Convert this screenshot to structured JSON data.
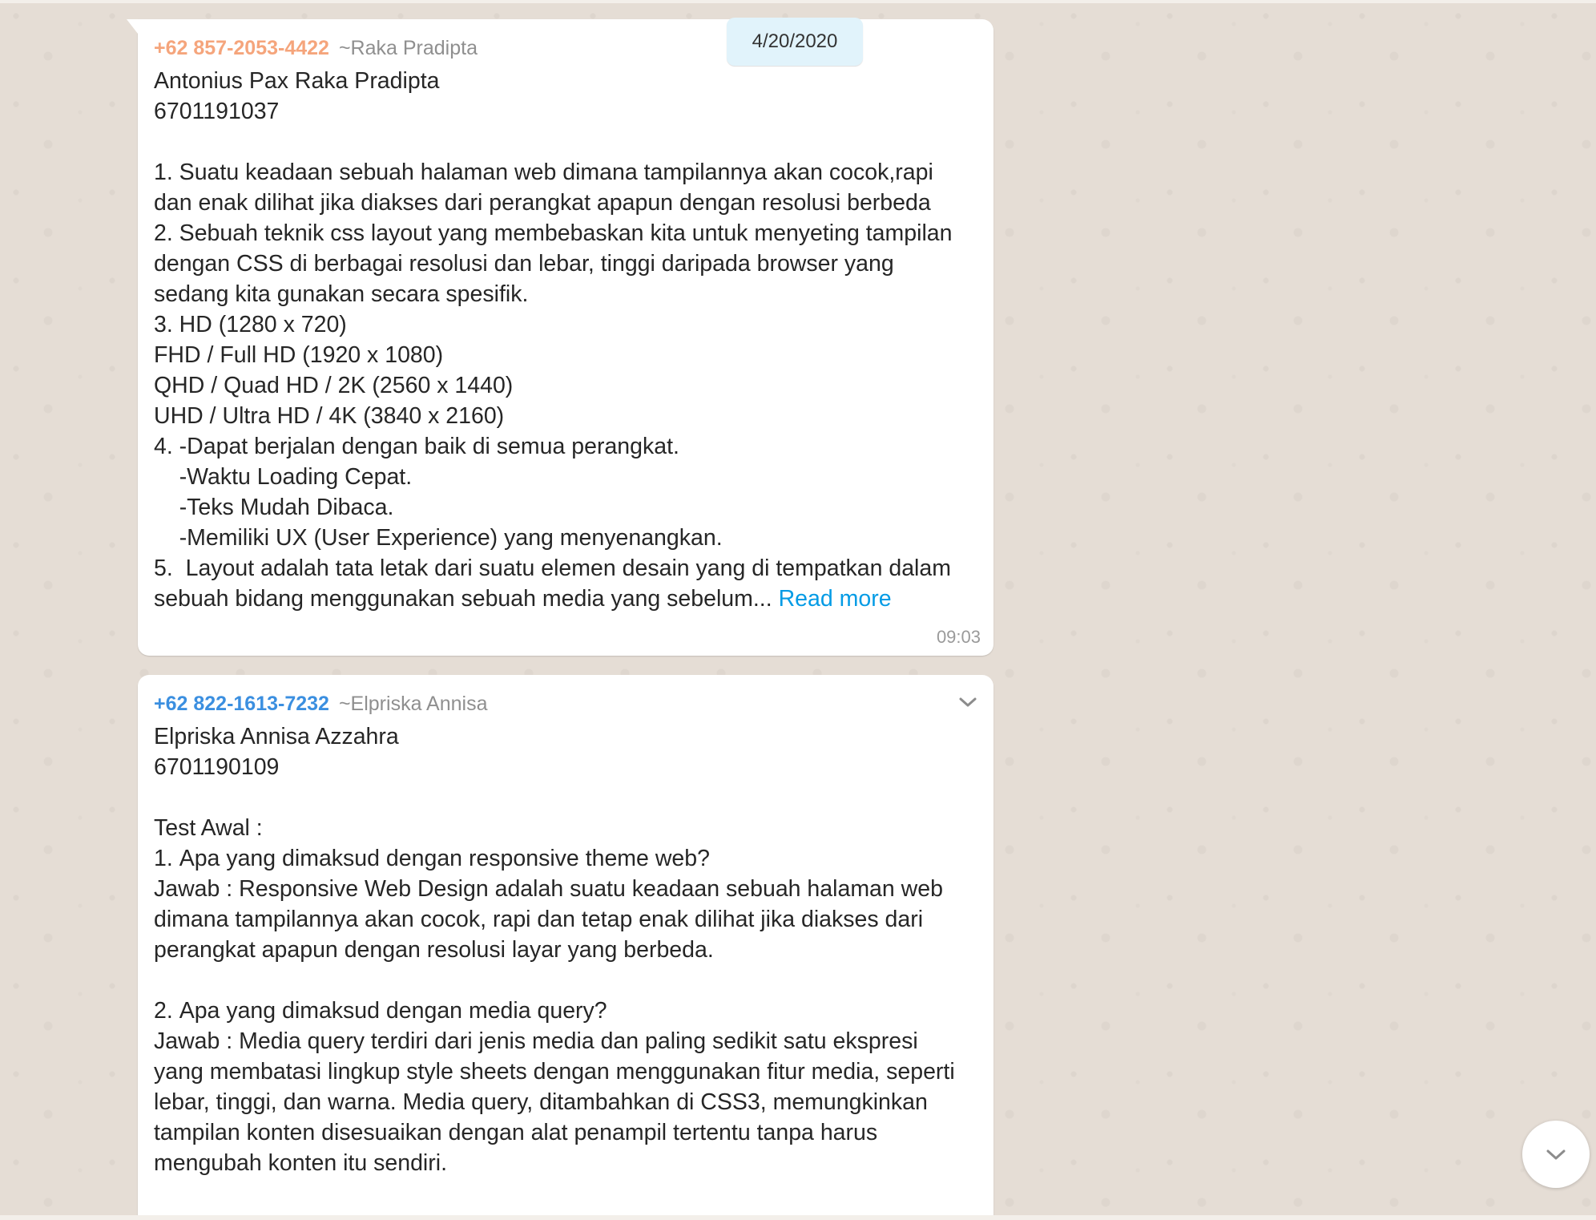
{
  "date_badge": "4/20/2020",
  "messages": [
    {
      "sender_phone": "+62 857-2053-4422",
      "sender_name": "~Raka Pradipta",
      "sender_color": "#f5a57c",
      "text": "Antonius Pax Raka Pradipta\n6701191037\n\n1. Suatu keadaan sebuah halaman web dimana tampilannya akan cocok,rapi\ndan enak dilihat jika diakses dari perangkat apapun dengan resolusi berbeda\n2. Sebuah teknik css layout yang membebaskan kita untuk menyeting tampilan\ndengan CSS di berbagai resolusi dan lebar, tinggi daripada browser yang\nsedang kita gunakan secara spesifik.\n3. HD (1280 x 720)\nFHD / Full HD (1920 x 1080)\nQHD / Quad HD / 2K (2560 x 1440)\nUHD / Ultra HD / 4K (3840 x 2160)\n4. -Dapat berjalan dengan baik di semua perangkat.\n    -Waktu Loading Cepat.\n    -Teks Mudah Dibaca.\n    -Memiliki UX (User Experience) yang menyenangkan.\n5.  Layout adalah tata letak dari suatu elemen desain yang di tempatkan dalam\nsebuah bidang menggunakan sebuah media yang sebelum... ",
      "read_more": "Read more",
      "time": "09:03"
    },
    {
      "sender_phone": "+62 822-1613-7232",
      "sender_name": "~Elpriska Annisa",
      "sender_color": "#3b8fe0",
      "text": "Elpriska Annisa Azzahra\n6701190109\n\nTest Awal :\n1.\tApa yang dimaksud dengan responsive theme web?\nJawab : Responsive Web Design adalah suatu keadaan sebuah halaman web\ndimana tampilannya akan cocok, rapi dan tetap enak dilihat jika diakses dari\nperangkat apapun dengan resolusi layar yang berbeda.\n\n2.\tApa yang dimaksud dengan media query?\nJawab : Media query terdiri dari jenis media dan paling sedikit satu ekspresi\nyang membatasi lingkup style sheets dengan menggunakan fitur media, seperti\nlebar, tinggi, dan warna. Media query, ditambahkan di CSS3, memungkinkan\ntampilan konten disesuaikan dengan alat penampil tertentu tanpa harus\nmengubah konten itu sendiri."
    }
  ],
  "icons": {
    "message_menu": "chevron-down-icon",
    "scroll_down": "chevron-down-icon"
  },
  "colors": {
    "chat_background": "#e5ddd5",
    "bubble": "#ffffff",
    "date_badge": "#e1f3fb",
    "link": "#039be5"
  }
}
